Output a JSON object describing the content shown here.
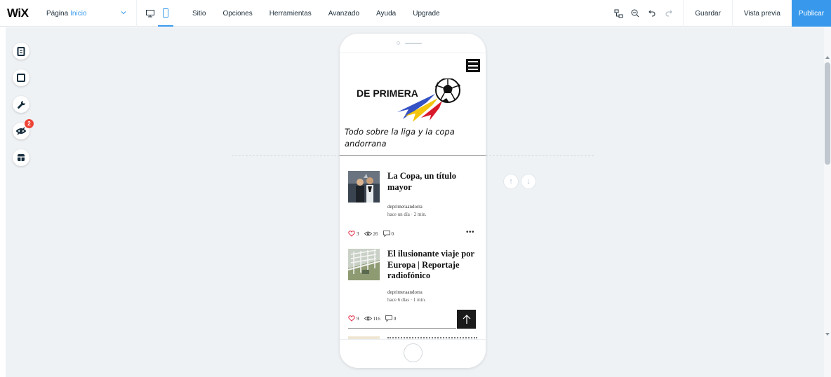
{
  "topbar": {
    "logo": "WiX",
    "page_label": "Página",
    "page_value": "Inicio",
    "menu": [
      "Sitio",
      "Opciones",
      "Herramientas",
      "Avanzado",
      "Ayuda",
      "Upgrade"
    ],
    "save_label": "Guardar",
    "preview_label": "Vista previa",
    "publish_label": "Publicar",
    "active_device": "mobile"
  },
  "sidebar": {
    "tools": [
      "pages-icon",
      "layout-icon",
      "tools-icon",
      "hidden-elements-icon",
      "sections-icon"
    ],
    "hidden_badge": "2"
  },
  "site": {
    "logo_text": "DE PRIMERA",
    "tagline": "Todo sobre la liga y la copa andorrana"
  },
  "posts": [
    {
      "title": "La Copa, un título mayor",
      "author": "deprimeraandorra",
      "meta": "hace un día · 2 min.",
      "likes": "3",
      "views": "26",
      "comments": "0"
    },
    {
      "title": "El ilusionante viaje por Europa | Reportaje radiofónico",
      "author": "deprimeraandorra",
      "meta": "hace 6 días · 1 min.",
      "likes": "9",
      "views": "116",
      "comments": "0"
    }
  ],
  "colors": {
    "accent": "#3899ec",
    "canvas_bg": "#eff2f5",
    "badge": "#ee4437",
    "heart": "#e0304a"
  }
}
